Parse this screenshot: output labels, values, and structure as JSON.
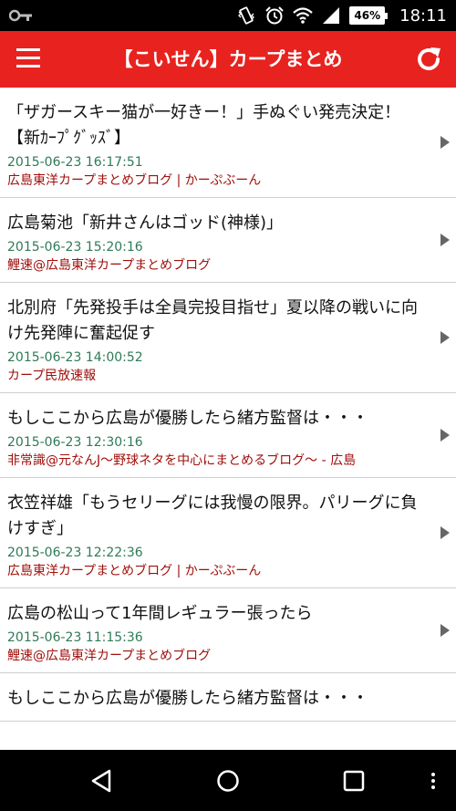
{
  "status_bar": {
    "battery": "46%",
    "time": "18:11",
    "icons": [
      "key-icon",
      "vibrate-icon",
      "alarm-icon",
      "wifi-icon",
      "signal-icon",
      "battery-icon"
    ]
  },
  "app_bar": {
    "title": "【こいせん】カープまとめ",
    "menu_icon": "hamburger-menu-icon",
    "refresh_icon": "refresh-icon"
  },
  "colors": {
    "app_bar": "#e8221e",
    "date": "#2e7a57",
    "source": "#a00f0b"
  },
  "articles": [
    {
      "title": "「ザガースキー猫が一好きー！」手ぬぐい発売決定！【新ｶｰﾌﾟｸﾞｯｽﾞ】",
      "date": "2015-06-23 16:17:51",
      "source": "広島東洋カープまとめブログ | かーぷぶーん"
    },
    {
      "title": "広島菊池「新井さんはゴッド(神様)」",
      "date": "2015-06-23 15:20:16",
      "source": "鯉速@広島東洋カープまとめブログ"
    },
    {
      "title": "北別府「先発投手は全員完投目指せ」夏以降の戦いに向け先発陣に奮起促す",
      "date": "2015-06-23 14:00:52",
      "source": "カープ民放速報"
    },
    {
      "title": "もしここから広島が優勝したら緒方監督は・・・",
      "date": "2015-06-23 12:30:16",
      "source": "非常識@元なんJ～野球ネタを中心にまとめるブログ～ - 広島"
    },
    {
      "title": "衣笠祥雄「もうセリーグには我慢の限界。パリーグに負けすぎ」",
      "date": "2015-06-23 12:22:36",
      "source": "広島東洋カープまとめブログ | かーぷぶーん"
    },
    {
      "title": "広島の松山って1年間レギュラー張ったら",
      "date": "2015-06-23 11:15:36",
      "source": "鯉速@広島東洋カープまとめブログ"
    },
    {
      "title": "もしここから広島が優勝したら緒方監督は・・・",
      "date": "",
      "source": ""
    }
  ],
  "nav_bar": {
    "buttons": [
      "back-icon",
      "home-icon",
      "recents-icon",
      "more-icon"
    ]
  }
}
